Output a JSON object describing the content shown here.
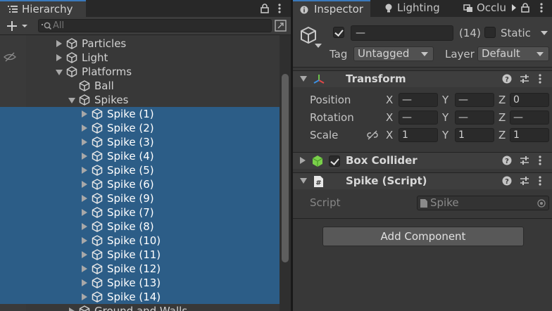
{
  "hierarchy": {
    "tab_title": "Hierarchy",
    "search_placeholder": "All",
    "items": [
      {
        "name": "Particles",
        "depth": 1,
        "expand": "collapsed",
        "selected": false
      },
      {
        "name": "Light",
        "depth": 1,
        "expand": "collapsed",
        "selected": false
      },
      {
        "name": "Platforms",
        "depth": 1,
        "expand": "expanded",
        "selected": false
      },
      {
        "name": "Ball",
        "depth": 2,
        "expand": "none",
        "selected": false
      },
      {
        "name": "Spikes",
        "depth": 2,
        "expand": "expanded",
        "selected": false
      },
      {
        "name": "Spike (1)",
        "depth": 3,
        "expand": "collapsed",
        "selected": true
      },
      {
        "name": "Spike (2)",
        "depth": 3,
        "expand": "collapsed",
        "selected": true
      },
      {
        "name": "Spike (3)",
        "depth": 3,
        "expand": "collapsed",
        "selected": true
      },
      {
        "name": "Spike (4)",
        "depth": 3,
        "expand": "collapsed",
        "selected": true
      },
      {
        "name": "Spike (5)",
        "depth": 3,
        "expand": "collapsed",
        "selected": true
      },
      {
        "name": "Spike (6)",
        "depth": 3,
        "expand": "collapsed",
        "selected": true
      },
      {
        "name": "Spike (9)",
        "depth": 3,
        "expand": "collapsed",
        "selected": true
      },
      {
        "name": "Spike (7)",
        "depth": 3,
        "expand": "collapsed",
        "selected": true
      },
      {
        "name": "Spike (8)",
        "depth": 3,
        "expand": "collapsed",
        "selected": true
      },
      {
        "name": "Spike (10)",
        "depth": 3,
        "expand": "collapsed",
        "selected": true
      },
      {
        "name": "Spike (11)",
        "depth": 3,
        "expand": "collapsed",
        "selected": true
      },
      {
        "name": "Spike (12)",
        "depth": 3,
        "expand": "collapsed",
        "selected": true
      },
      {
        "name": "Spike (13)",
        "depth": 3,
        "expand": "collapsed",
        "selected": true
      },
      {
        "name": "Spike (14)",
        "depth": 3,
        "expand": "collapsed",
        "selected": true
      },
      {
        "name": "Ground and Walls",
        "depth": 2,
        "expand": "collapsed",
        "selected": false
      }
    ]
  },
  "inspector": {
    "tabs": {
      "inspector": "Inspector",
      "lighting": "Lighting",
      "occlusion": "Occlu"
    },
    "object": {
      "active": true,
      "name_value": "—",
      "count": "(14)",
      "static_label": "Static",
      "static_checked": false,
      "tag_label": "Tag",
      "tag_value": "Untagged",
      "layer_label": "Layer",
      "layer_value": "Default"
    },
    "transform": {
      "title": "Transform",
      "position": {
        "label": "Position",
        "x": "—",
        "y": "—",
        "z": "0"
      },
      "rotation": {
        "label": "Rotation",
        "x": "—",
        "y": "—",
        "z": "—"
      },
      "scale": {
        "label": "Scale",
        "x": "1",
        "y": "1",
        "z": "1"
      },
      "axis_x": "X",
      "axis_y": "Y",
      "axis_z": "Z"
    },
    "box_collider": {
      "title": "Box Collider",
      "enabled": true
    },
    "script_component": {
      "title": "Spike (Script)",
      "script_label": "Script",
      "script_value": "Spike"
    },
    "add_component_label": "Add Component"
  },
  "colors": {
    "selection": "#2c5d87",
    "panel_bg": "#383838",
    "tab_accent": "#3a79bb"
  }
}
